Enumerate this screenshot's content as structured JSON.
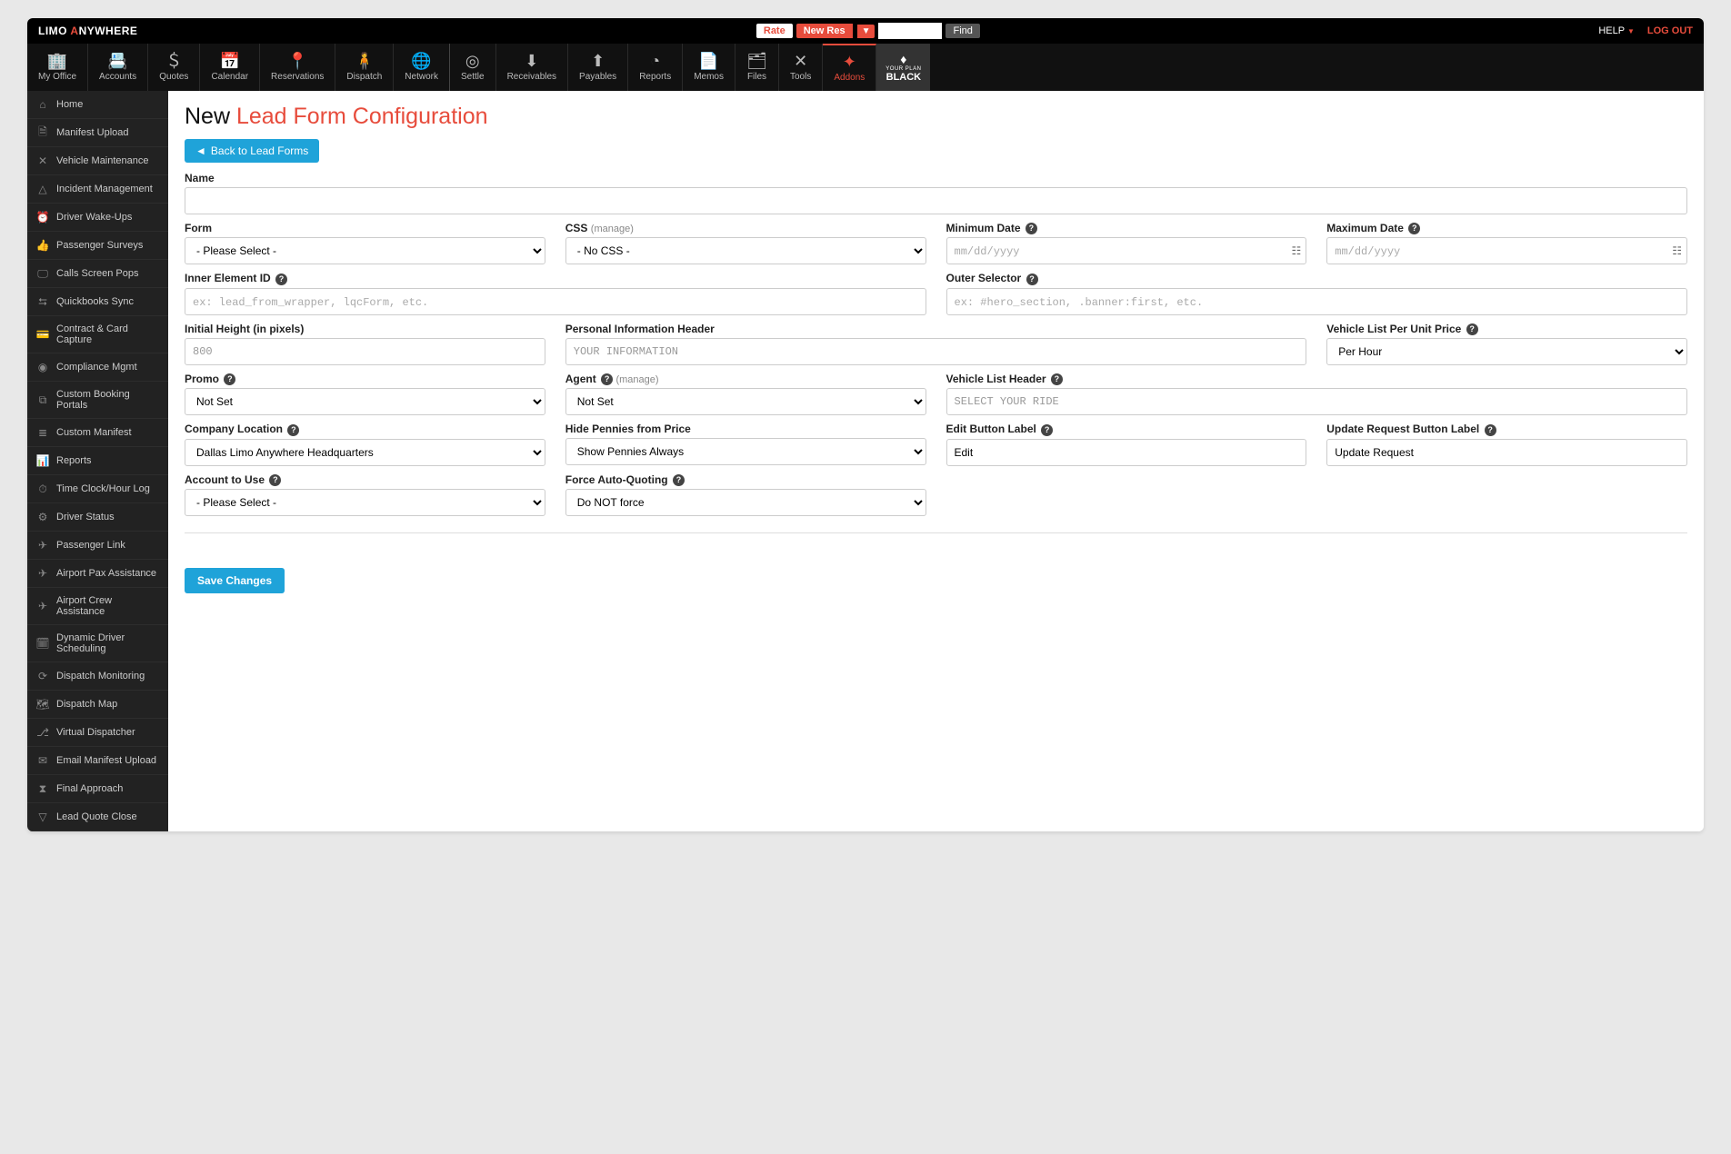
{
  "topbar": {
    "logo_prefix": "LIMO ",
    "logo_a": "A",
    "logo_suffix": "NYWHERE",
    "rate": "Rate",
    "new_res": "New Res",
    "find": "Find",
    "help": "HELP",
    "logout": "LOG OUT"
  },
  "nav": [
    {
      "label": "My Office",
      "icon": "building"
    },
    {
      "label": "Accounts",
      "icon": "card"
    },
    {
      "label": "Quotes",
      "icon": "dollar-page"
    },
    {
      "label": "Calendar",
      "icon": "calendar"
    },
    {
      "label": "Reservations",
      "icon": "pin"
    },
    {
      "label": "Dispatch",
      "icon": "person-pin"
    },
    {
      "label": "Network",
      "icon": "globe",
      "bordered": true
    },
    {
      "label": "Settle",
      "icon": "chip"
    },
    {
      "label": "Receivables",
      "icon": "download"
    },
    {
      "label": "Payables",
      "icon": "upload"
    },
    {
      "label": "Reports",
      "icon": "pie"
    },
    {
      "label": "Memos",
      "icon": "page"
    },
    {
      "label": "Files",
      "icon": "folder"
    },
    {
      "label": "Tools",
      "icon": "wrench"
    },
    {
      "label": "Addons",
      "icon": "spark",
      "active": true
    }
  ],
  "nav_black": {
    "plan": "YOUR PLAN",
    "label": "BLACK"
  },
  "sidebar": [
    {
      "label": "Home",
      "icon": "home"
    },
    {
      "label": "Manifest Upload",
      "icon": "doc"
    },
    {
      "label": "Vehicle Maintenance",
      "icon": "wrench"
    },
    {
      "label": "Incident Management",
      "icon": "warning"
    },
    {
      "label": "Driver Wake-Ups",
      "icon": "alarm"
    },
    {
      "label": "Passenger Surveys",
      "icon": "thumb"
    },
    {
      "label": "Calls Screen Pops",
      "icon": "screen"
    },
    {
      "label": "Quickbooks Sync",
      "icon": "qb"
    },
    {
      "label": "Contract & Card Capture",
      "icon": "card2"
    },
    {
      "label": "Compliance Mgmt",
      "icon": "badge"
    },
    {
      "label": "Custom Booking Portals",
      "icon": "portal"
    },
    {
      "label": "Custom Manifest",
      "icon": "list"
    },
    {
      "label": "Reports",
      "icon": "bar"
    },
    {
      "label": "Time Clock/Hour Log",
      "icon": "stopwatch"
    },
    {
      "label": "Driver Status",
      "icon": "gear"
    },
    {
      "label": "Passenger Link",
      "icon": "send"
    },
    {
      "label": "Airport Pax Assistance",
      "icon": "plane-user"
    },
    {
      "label": "Airport Crew Assistance",
      "icon": "plane-users"
    },
    {
      "label": "Dynamic Driver Scheduling",
      "icon": "sched"
    },
    {
      "label": "Dispatch Monitoring",
      "icon": "monitor"
    },
    {
      "label": "Dispatch Map",
      "icon": "map2"
    },
    {
      "label": "Virtual Dispatcher",
      "icon": "branch"
    },
    {
      "label": "Email Manifest Upload",
      "icon": "mail"
    },
    {
      "label": "Final Approach",
      "icon": "hourglass"
    },
    {
      "label": "Lead Quote Close",
      "icon": "funnel"
    }
  ],
  "page": {
    "title_prefix": "New ",
    "title_accent": "Lead Form Configuration",
    "back_button": "Back to Lead Forms",
    "save_button": "Save Changes"
  },
  "form": {
    "name": {
      "label": "Name",
      "value": ""
    },
    "form_select": {
      "label": "Form",
      "value": "- Please Select -"
    },
    "css_select": {
      "label": "CSS",
      "manage": "(manage)",
      "value": "- No CSS -"
    },
    "min_date": {
      "label": "Minimum Date",
      "placeholder": "mm/dd/yyyy",
      "value": ""
    },
    "max_date": {
      "label": "Maximum Date",
      "placeholder": "mm/dd/yyyy",
      "value": ""
    },
    "inner_el": {
      "label": "Inner Element ID",
      "placeholder": "ex: lead_from_wrapper, lqcForm, etc.",
      "value": ""
    },
    "outer_sel": {
      "label": "Outer Selector",
      "placeholder": "ex: #hero_section, .banner:first, etc.",
      "value": ""
    },
    "init_height": {
      "label": "Initial Height (in pixels)",
      "value": "800"
    },
    "pi_header": {
      "label": "Personal Information Header",
      "value": "YOUR INFORMATION"
    },
    "vlist_price": {
      "label": "Vehicle List Per Unit Price",
      "value": "Per Hour"
    },
    "promo": {
      "label": "Promo",
      "value": "Not Set"
    },
    "agent": {
      "label": "Agent",
      "manage": "(manage)",
      "value": "Not Set"
    },
    "vlist_header": {
      "label": "Vehicle List Header",
      "value": "SELECT YOUR RIDE"
    },
    "company_loc": {
      "label": "Company Location",
      "value": "Dallas Limo Anywhere Headquarters"
    },
    "hide_pennies": {
      "label": "Hide Pennies from Price",
      "value": "Show Pennies Always"
    },
    "edit_btn": {
      "label": "Edit Button Label",
      "value": "Edit"
    },
    "update_btn": {
      "label": "Update Request Button Label",
      "value": "Update Request"
    },
    "account": {
      "label": "Account to Use",
      "value": "- Please Select -"
    },
    "force_auto": {
      "label": "Force Auto-Quoting",
      "value": "Do NOT force"
    }
  }
}
